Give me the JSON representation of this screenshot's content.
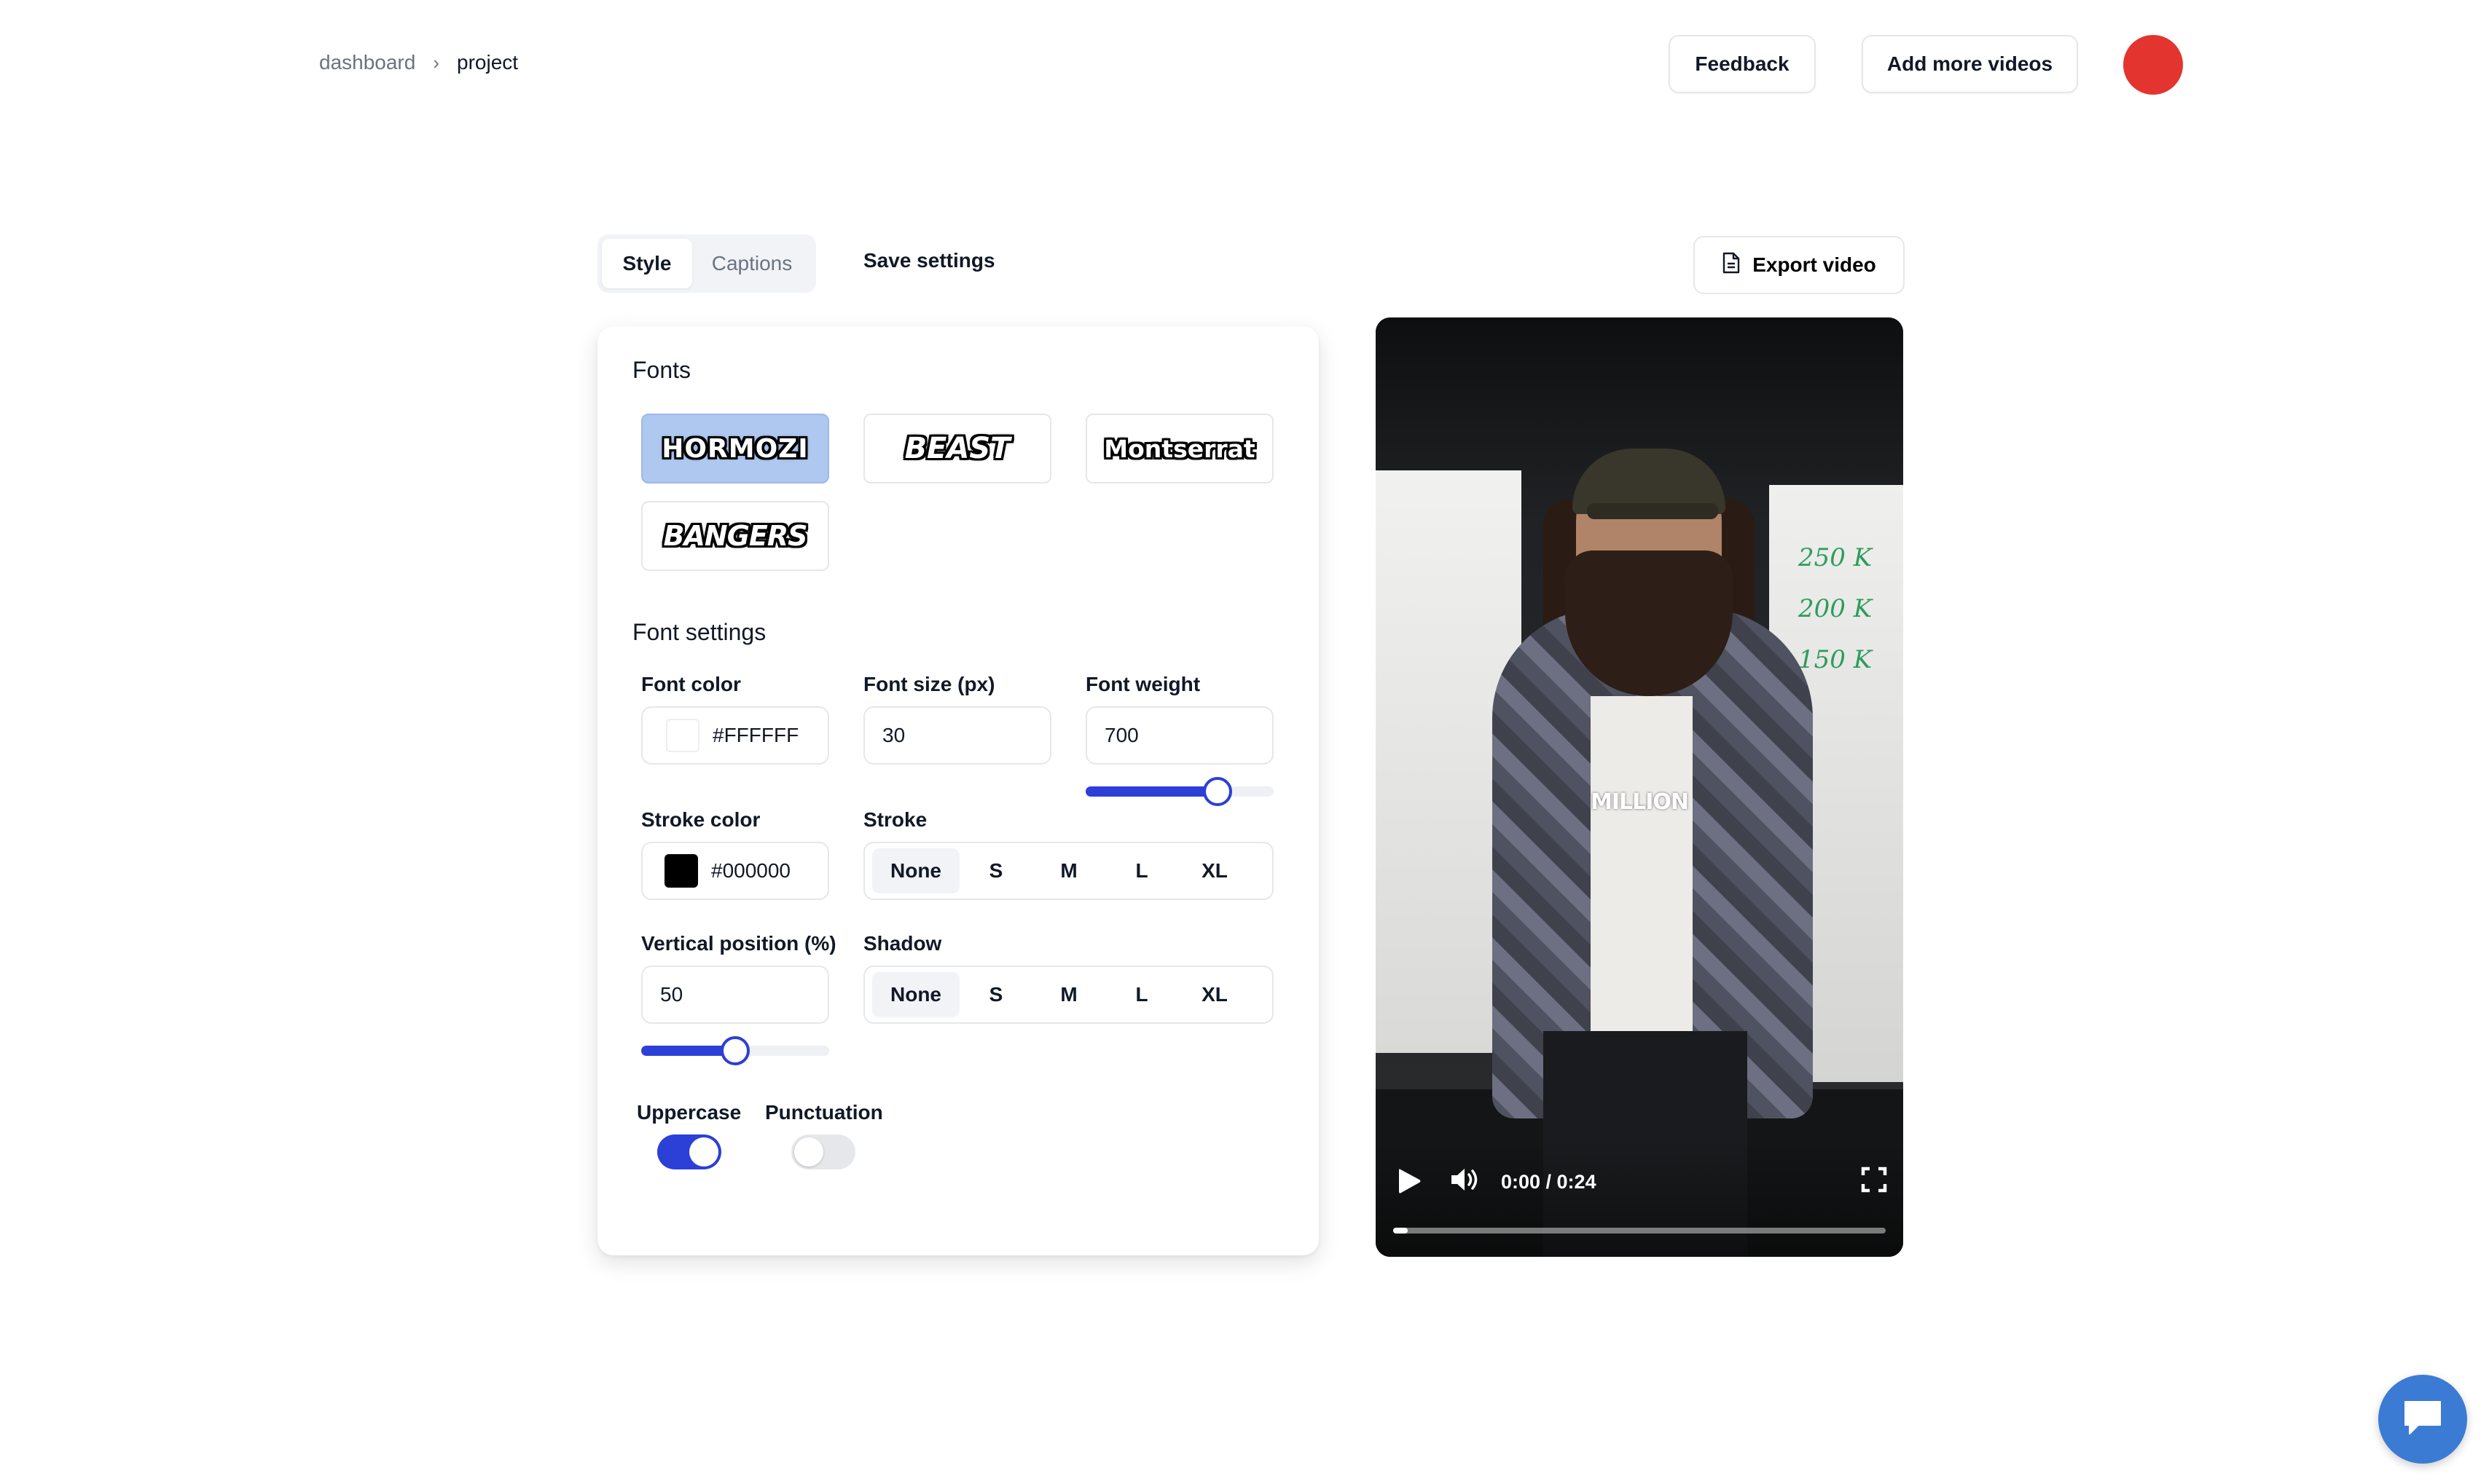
{
  "breadcrumb": {
    "root": "dashboard",
    "separator": "›",
    "current": "project"
  },
  "header": {
    "feedback_label": "Feedback",
    "add_videos_label": "Add more videos",
    "avatar_color": "#e3342f"
  },
  "tabs": [
    {
      "label": "Style",
      "active": true
    },
    {
      "label": "Captions",
      "active": false
    }
  ],
  "toolbar": {
    "save_label": "Save settings",
    "export_label": "Export video",
    "export_icon": "document-icon"
  },
  "fonts": {
    "title": "Fonts",
    "options": [
      {
        "label": "HORMOZI",
        "selected": true
      },
      {
        "label": "BEAST",
        "selected": false
      },
      {
        "label": "Montserrat",
        "selected": false
      },
      {
        "label": "BANGERS",
        "selected": false
      }
    ]
  },
  "font_settings": {
    "title": "Font settings",
    "font_color": {
      "label": "Font color",
      "value": "#FFFFFF"
    },
    "font_size": {
      "label": "Font size (px)",
      "value": "30"
    },
    "font_weight": {
      "label": "Font weight",
      "value": "700",
      "slider_fraction": 0.7
    },
    "stroke_color": {
      "label": "Stroke color",
      "value": "#000000"
    },
    "stroke": {
      "label": "Stroke",
      "options": [
        "None",
        "S",
        "M",
        "L",
        "XL"
      ],
      "selected": "None"
    },
    "vertical_position": {
      "label": "Vertical position (%)",
      "value": "50",
      "slider_fraction": 0.5
    },
    "shadow": {
      "label": "Shadow",
      "options": [
        "None",
        "S",
        "M",
        "L",
        "XL"
      ],
      "selected": "None"
    },
    "uppercase": {
      "label": "Uppercase",
      "on": true
    },
    "punctuation": {
      "label": "Punctuation",
      "on": false
    }
  },
  "video": {
    "caption_text": "MILLION",
    "board_lines": [
      "250 K",
      "200 K",
      "150 K"
    ],
    "time": "0:00 / 0:24",
    "progress_fraction": 0.03
  },
  "chat": {
    "icon": "chat-bubble-icon",
    "color": "#3b7bd4"
  }
}
